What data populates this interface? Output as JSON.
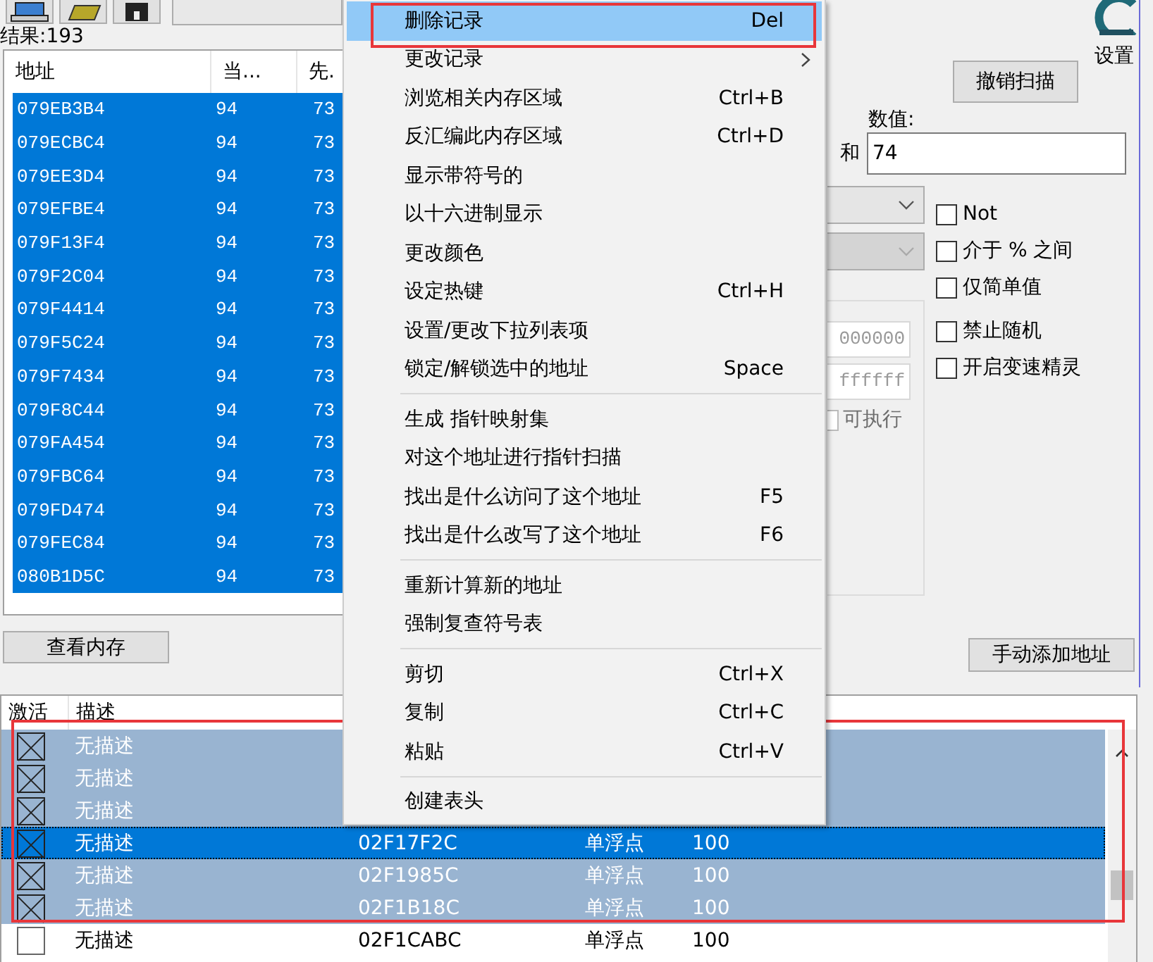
{
  "results_label": "结果:193",
  "results": {
    "columns": [
      "地址",
      "当...",
      "先."
    ],
    "rows": [
      {
        "address": "079EB3B4",
        "value": "94",
        "previous": "73",
        "selected": true
      },
      {
        "address": "079ECBC4",
        "value": "94",
        "previous": "73",
        "selected": true
      },
      {
        "address": "079EE3D4",
        "value": "94",
        "previous": "73",
        "selected": true
      },
      {
        "address": "079EFBE4",
        "value": "94",
        "previous": "73",
        "selected": true
      },
      {
        "address": "079F13F4",
        "value": "94",
        "previous": "73",
        "selected": true
      },
      {
        "address": "079F2C04",
        "value": "94",
        "previous": "73",
        "selected": true
      },
      {
        "address": "079F4414",
        "value": "94",
        "previous": "73",
        "selected": true
      },
      {
        "address": "079F5C24",
        "value": "94",
        "previous": "73",
        "selected": true
      },
      {
        "address": "079F7434",
        "value": "94",
        "previous": "73",
        "selected": true
      },
      {
        "address": "079F8C44",
        "value": "94",
        "previous": "73",
        "selected": true
      },
      {
        "address": "079FA454",
        "value": "94",
        "previous": "73",
        "selected": true
      },
      {
        "address": "079FBC64",
        "value": "94",
        "previous": "73",
        "selected": true
      },
      {
        "address": "079FD474",
        "value": "94",
        "previous": "73",
        "selected": true
      },
      {
        "address": "079FEC84",
        "value": "94",
        "previous": "73",
        "selected": true
      },
      {
        "address": "080B1D5C",
        "value": "94",
        "previous": "73",
        "selected": true
      }
    ]
  },
  "view_memory_button": "查看内存",
  "context_menu": {
    "items": [
      {
        "kind": "item",
        "label": "删除记录",
        "shortcut": "Del",
        "selected": true,
        "highlighted": true
      },
      {
        "kind": "item",
        "label": "更改记录",
        "submenu": true,
        "selected": false
      },
      {
        "kind": "item",
        "label": "浏览相关内存区域",
        "shortcut": "Ctrl+B",
        "selected": false
      },
      {
        "kind": "item",
        "label": "反汇编此内存区域",
        "shortcut": "Ctrl+D",
        "selected": false
      },
      {
        "kind": "item",
        "label": "显示带符号的",
        "selected": false
      },
      {
        "kind": "item",
        "label": "以十六进制显示",
        "selected": false
      },
      {
        "kind": "item",
        "label": "更改颜色",
        "selected": false
      },
      {
        "kind": "item",
        "label": "设定热键",
        "shortcut": "Ctrl+H",
        "selected": false
      },
      {
        "kind": "item",
        "label": "设置/更改下拉列表项",
        "selected": false
      },
      {
        "kind": "item",
        "label": "锁定/解锁选中的地址",
        "shortcut": "Space",
        "selected": false
      },
      {
        "kind": "separator"
      },
      {
        "kind": "item",
        "label": "生成 指针映射集",
        "selected": false
      },
      {
        "kind": "item",
        "label": "对这个地址进行指针扫描",
        "selected": false
      },
      {
        "kind": "item",
        "label": "找出是什么访问了这个地址",
        "shortcut": "F5",
        "selected": false
      },
      {
        "kind": "item",
        "label": "找出是什么改写了这个地址",
        "shortcut": "F6",
        "selected": false
      },
      {
        "kind": "separator"
      },
      {
        "kind": "item",
        "label": "重新计算新的地址",
        "selected": false
      },
      {
        "kind": "item",
        "label": "强制复查符号表",
        "selected": false
      },
      {
        "kind": "separator"
      },
      {
        "kind": "item",
        "label": "剪切",
        "shortcut": "Ctrl+X",
        "selected": false
      },
      {
        "kind": "item",
        "label": "复制",
        "shortcut": "Ctrl+C",
        "selected": false
      },
      {
        "kind": "item",
        "label": "粘贴",
        "shortcut": "Ctrl+V",
        "selected": false
      },
      {
        "kind": "separator"
      },
      {
        "kind": "item",
        "label": "创建表头",
        "selected": false
      }
    ]
  },
  "settings_label": "设置",
  "undo_scan_button": "撤销扫描",
  "value_label": "数值:",
  "and_label": "和",
  "value_input": "74",
  "options": [
    {
      "label": "Not",
      "checked": false
    },
    {
      "label": "介于 % 之间",
      "checked": false
    },
    {
      "label": "仅简单值",
      "checked": false
    },
    {
      "label": "禁止随机",
      "checked": false
    },
    {
      "label": "开启变速精灵",
      "checked": false
    }
  ],
  "memory_range": {
    "start": "000000",
    "end": "ffffff",
    "executable_label": "可执行",
    "executable_checked": false
  },
  "add_address_button": "手动添加地址",
  "address_list": {
    "columns": [
      "激活",
      "描述"
    ],
    "highlighted": true,
    "rows": [
      {
        "active": true,
        "description": "无描述",
        "selected": true,
        "focused": false
      },
      {
        "active": true,
        "description": "无描述",
        "selected": true,
        "focused": false
      },
      {
        "active": true,
        "description": "无描述",
        "selected": true,
        "focused": false
      },
      {
        "active": true,
        "description": "无描述",
        "address": "02F17F2C",
        "type": "单浮点",
        "value": "100",
        "selected": true,
        "focused": true
      },
      {
        "active": true,
        "description": "无描述",
        "address": "02F1985C",
        "type": "单浮点",
        "value": "100",
        "selected": true,
        "focused": false
      },
      {
        "active": true,
        "description": "无描述",
        "address": "02F1B18C",
        "type": "单浮点",
        "value": "100",
        "selected": true,
        "focused": false
      },
      {
        "active": false,
        "description": "无描述",
        "address": "02F1CABC",
        "type": "单浮点",
        "value": "100",
        "selected": false,
        "focused": false
      }
    ]
  }
}
